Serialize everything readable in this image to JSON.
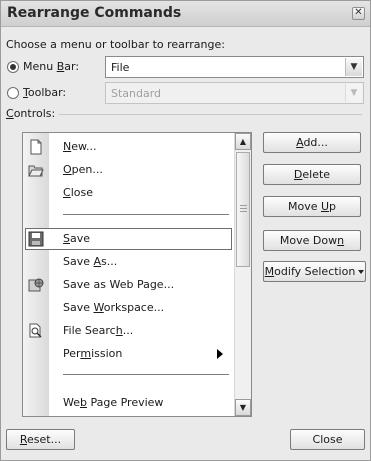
{
  "dialog": {
    "title": "Rearrange Commands",
    "close_glyph": "✕",
    "choose_label": "Choose a menu or toolbar to rearrange:",
    "menubar_label": "Menu Bar:",
    "menubar_value": "File",
    "toolbar_label": "Toolbar:",
    "toolbar_value": "Standard",
    "controls_label": "Controls:"
  },
  "controls": {
    "items": [
      {
        "label": "New...",
        "icon": "new-document-icon"
      },
      {
        "label": "Open...",
        "icon": "open-folder-icon"
      },
      {
        "label": "Close",
        "icon": ""
      },
      {
        "label": "Save",
        "icon": "save-disk-icon",
        "selected": true
      },
      {
        "label": "Save As...",
        "icon": ""
      },
      {
        "label": "Save as Web Page...",
        "icon": "web-page-icon"
      },
      {
        "label": "Save Workspace...",
        "icon": ""
      },
      {
        "label": "File Search...",
        "icon": "file-search-icon"
      },
      {
        "label": "Permission",
        "icon": "",
        "submenu": true
      },
      {
        "label": "Web Page Preview",
        "icon": ""
      }
    ],
    "scroll_up_glyph": "▲",
    "scroll_down_glyph": "▼"
  },
  "buttons": {
    "add": "Add...",
    "delete": "Delete",
    "move_up": "Move Up",
    "move_down": "Move Down",
    "modify_selection": "Modify Selection",
    "reset": "Reset...",
    "close": "Close"
  },
  "dropdown_glyph": "▾"
}
